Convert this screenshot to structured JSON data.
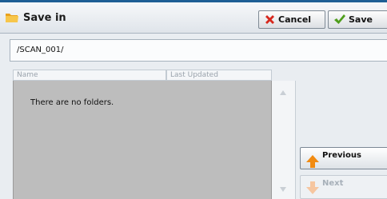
{
  "header": {
    "title": "Save in",
    "cancel_label": "Cancel",
    "save_label": "Save"
  },
  "path": {
    "value": "/SCAN_001/"
  },
  "folder_list": {
    "columns": [
      "Name",
      "Last Updated"
    ],
    "empty_message": "There are no folders."
  },
  "pager": {
    "previous_label": "Previous",
    "next_label": "Next"
  },
  "icons": {
    "title_icon": "folder-icon",
    "cancel_icon": "x-icon",
    "save_icon": "checkmark-icon",
    "previous_icon": "arrow-up-icon",
    "next_icon": "arrow-down-icon"
  },
  "colors": {
    "accent_bar": "#1f5f95",
    "cancel_icon": "#d7281d",
    "save_icon": "#4f9e1c",
    "previous_icon": "#f18b12",
    "list_background": "#bdbdbd"
  }
}
